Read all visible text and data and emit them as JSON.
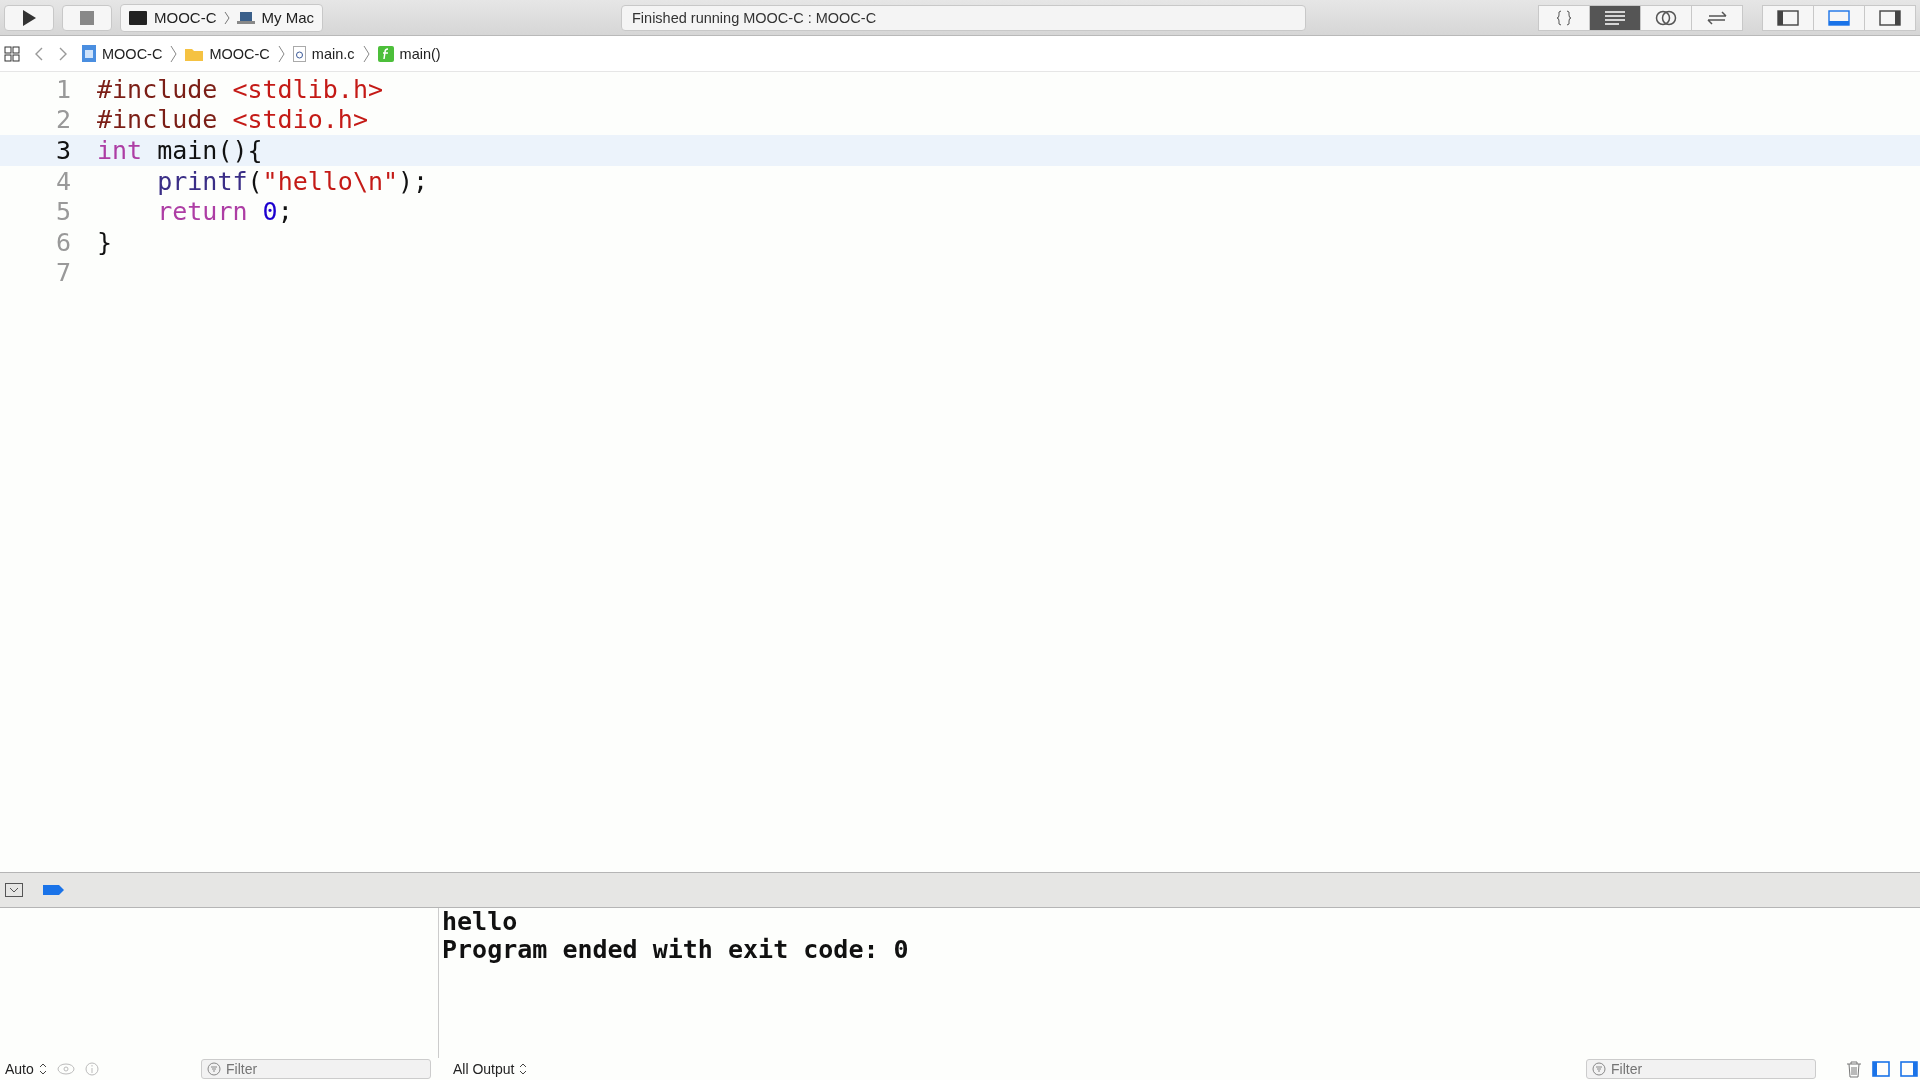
{
  "toolbar": {
    "scheme": {
      "target": "MOOC-C",
      "destination": "My Mac"
    },
    "activity": "Finished running MOOC-C : MOOC-C",
    "editor_modes": [
      {
        "kind": "braces",
        "selected": false
      },
      {
        "kind": "standard",
        "selected": true
      },
      {
        "kind": "assistant",
        "selected": false
      },
      {
        "kind": "version",
        "selected": false
      }
    ],
    "panels": [
      {
        "kind": "left",
        "on": false
      },
      {
        "kind": "bottom",
        "on": true
      },
      {
        "kind": "right",
        "on": false
      }
    ]
  },
  "breadcrumbs": [
    {
      "kind": "project",
      "label": "MOOC-C"
    },
    {
      "kind": "folder",
      "label": "MOOC-C"
    },
    {
      "kind": "file",
      "label": "main.c"
    },
    {
      "kind": "function",
      "label": "main()"
    }
  ],
  "code": [
    {
      "number": "1",
      "selected": false,
      "tokens": [
        {
          "kind": "preproc",
          "text": "#include "
        },
        {
          "kind": "string",
          "text": "<stdlib.h>"
        }
      ]
    },
    {
      "number": "2",
      "selected": false,
      "tokens": [
        {
          "kind": "preproc",
          "text": "#include "
        },
        {
          "kind": "string",
          "text": "<stdio.h>"
        }
      ]
    },
    {
      "number": "3",
      "selected": true,
      "tokens": [
        {
          "kind": "keyword",
          "text": "int"
        },
        {
          "kind": "plain",
          "text": " main(){"
        }
      ]
    },
    {
      "number": "4",
      "selected": false,
      "indented": true,
      "tokens": [
        {
          "kind": "function",
          "text": "printf"
        },
        {
          "kind": "plain",
          "text": "("
        },
        {
          "kind": "string",
          "text": "\"hello\\n\""
        },
        {
          "kind": "plain",
          "text": ");"
        }
      ]
    },
    {
      "number": "5",
      "selected": false,
      "indented": true,
      "tokens": [
        {
          "kind": "keyword",
          "text": "return "
        },
        {
          "kind": "number",
          "text": "0"
        },
        {
          "kind": "plain",
          "text": ";"
        }
      ]
    },
    {
      "number": "6",
      "selected": false,
      "tokens": [
        {
          "kind": "plain",
          "text": "}"
        }
      ]
    },
    {
      "number": "7",
      "selected": false
    }
  ],
  "debug_bar": {
    "breakpoints_on": true
  },
  "console": {
    "lines": [
      "hello",
      "Program ended with exit code: 0"
    ]
  },
  "variables_footer": {
    "mode": "Auto",
    "filter_placeholder": "Filter"
  },
  "console_footer": {
    "mode": "All Output",
    "filter_placeholder": "Filter"
  },
  "split_views": [
    {
      "kind": "left",
      "on": true
    },
    {
      "kind": "right",
      "on": true
    }
  ]
}
